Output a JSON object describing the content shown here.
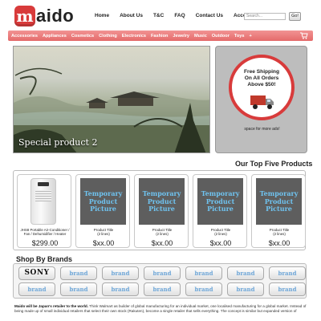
{
  "header": {
    "logo_letter": "m",
    "logo_text": "aido",
    "nav": [
      "Home",
      "About Us",
      "T&C",
      "FAQ",
      "Contact Us",
      "Account"
    ],
    "search_placeholder": "Search...",
    "go_label": "Go!"
  },
  "categories": [
    "Accessories",
    "Appliances",
    "Cosmetics",
    "Clothing",
    "Electronics",
    "Fashion",
    "Jewelry",
    "Music",
    "Outdoor",
    "Toys",
    "+"
  ],
  "banner": {
    "caption": "Special product 2"
  },
  "shipping": {
    "line1": "Free Shipping",
    "line2": "On All Orders",
    "line3": "Above $50!",
    "space_text": "space for more ads!"
  },
  "top_five": {
    "title": "Our Top Five Products",
    "products": [
      {
        "title_l1": "JHS8 Portable Air-Conditioner /",
        "title_l2": "Fan / Dehumidifier / Heater",
        "price": "$299.00",
        "placeholder": ""
      },
      {
        "title_l1": "Product Title",
        "title_l2": "(2 lines)",
        "price": "$xx.00",
        "placeholder": "Temporary Product Picture"
      },
      {
        "title_l1": "Product Title",
        "title_l2": "(2 lines)",
        "price": "$xx.00",
        "placeholder": "Temporary Product Picture"
      },
      {
        "title_l1": "Product Title",
        "title_l2": "(2 lines)",
        "price": "$xx.00",
        "placeholder": "Temporary Product Picture"
      },
      {
        "title_l1": "Product Title",
        "title_l2": "(2 lines)",
        "price": "$xx.00",
        "placeholder": "Temporary Product Picture"
      }
    ]
  },
  "brands": {
    "title": "Shop By Brands",
    "items": [
      "SONY",
      "brand",
      "brand",
      "brand",
      "brand",
      "brand",
      "brand",
      "brand",
      "brand",
      "brand",
      "brand",
      "brand",
      "brand",
      "brand"
    ]
  },
  "about": {
    "lead": "Maido will be Japan's retailer to the world.",
    "body": " Think Walmart as builder of global manufacturing for an individual market, one localised manufacturing for a global market. Instead of being made up of small individual retailers that select their own stock (Rakuten), become a single retailer that sells everything. The concept is similar but expanded version of"
  },
  "colors": {
    "accent": "#e46a6a",
    "logo_red": "#d83b3b",
    "placeholder_text": "#6fc3f0"
  }
}
